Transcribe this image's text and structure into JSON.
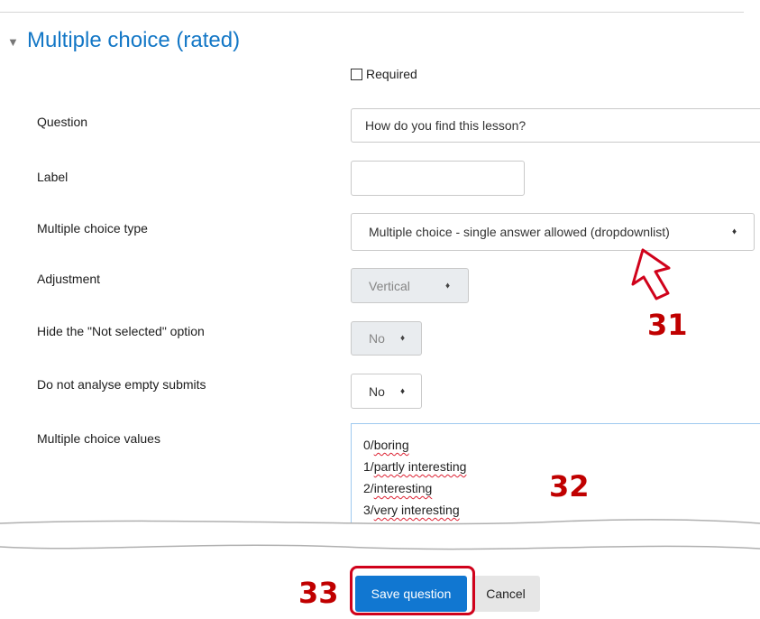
{
  "section": {
    "title": "Multiple choice (rated)",
    "toggle_icon": "triangle-down-icon"
  },
  "required": {
    "label": "Required",
    "checked": false
  },
  "question": {
    "label": "Question",
    "value": "How do you find this lesson?"
  },
  "label_field": {
    "label": "Label",
    "value": ""
  },
  "choice_type": {
    "label": "Multiple choice type",
    "value": "Multiple choice - single answer allowed (dropdownlist)",
    "arrow": "♦"
  },
  "adjustment": {
    "label": "Adjustment",
    "value": "Vertical",
    "arrow": "♦"
  },
  "hide_not_selected": {
    "label": "Hide the \"Not selected\" option",
    "value": "No",
    "arrow": "♦"
  },
  "no_analyse_empty": {
    "label": "Do not analyse empty submits",
    "value": "No",
    "arrow": "♦"
  },
  "choice_values": {
    "label": "Multiple choice values",
    "lines": [
      {
        "num": "0/",
        "text": "boring"
      },
      {
        "num": "1/",
        "text": "partly interesting"
      },
      {
        "num": "2/",
        "text": "interesting"
      },
      {
        "num": "3/",
        "text": "very interesting"
      }
    ]
  },
  "callouts": {
    "c31": "31",
    "c32": "32",
    "c33": "33"
  },
  "buttons": {
    "save": "Save question",
    "cancel": "Cancel"
  },
  "colors": {
    "accent": "#1377c6",
    "primary_button": "#1177d1",
    "callout": "#c00000",
    "highlight": "#d0021b"
  }
}
